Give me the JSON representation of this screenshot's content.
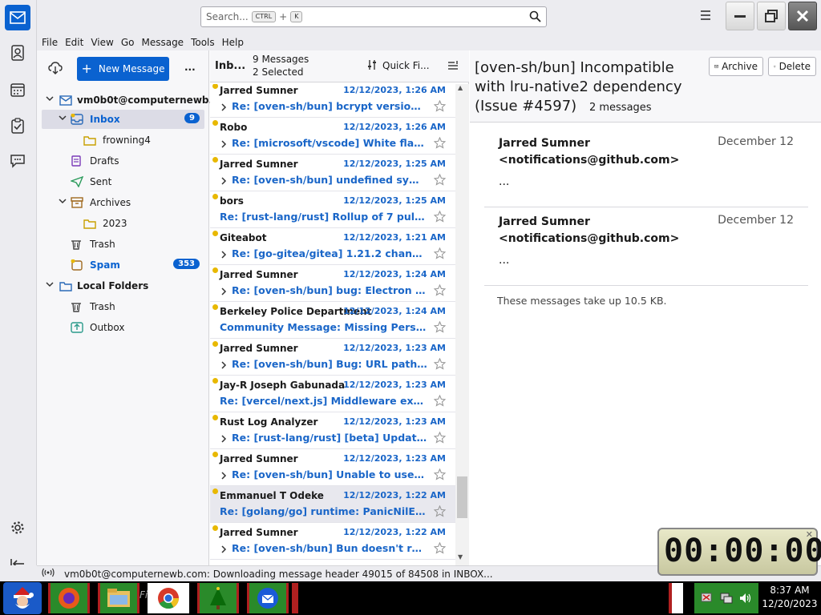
{
  "search": {
    "placeholder": "Search...",
    "key1": "CTRL",
    "plus": "+",
    "key2": "K"
  },
  "menu": [
    "File",
    "Edit",
    "View",
    "Go",
    "Message",
    "Tools",
    "Help"
  ],
  "folders": {
    "new_message": "New Message",
    "more": "...",
    "account": "vm0b0t@computernewb...",
    "items": [
      {
        "label": "Inbox",
        "badge": "9"
      },
      {
        "label": "frowning4"
      },
      {
        "label": "Drafts"
      },
      {
        "label": "Sent"
      },
      {
        "label": "Archives"
      },
      {
        "label": "2023"
      },
      {
        "label": "Trash"
      },
      {
        "label": "Spam",
        "badge": "353"
      }
    ],
    "local": "Local Folders",
    "local_items": [
      {
        "label": "Trash"
      },
      {
        "label": "Outbox"
      }
    ]
  },
  "list": {
    "folder": "Inb...",
    "count": "9 Messages",
    "selected": "2 Selected",
    "quick_filter": "Quick Fi...",
    "rows": [
      {
        "sender": "Jarred Sumner",
        "date": "12/12/2023, 1:26 AM",
        "subject": "Re: [oven-sh/bun] bcrypt version @5...."
      },
      {
        "sender": "Robo",
        "date": "12/12/2023, 1:26 AM",
        "subject": "Re: [microsoft/vscode] White flash w..."
      },
      {
        "sender": "Jarred Sumner",
        "date": "12/12/2023, 1:25 AM",
        "subject": "Re: [oven-sh/bun] undefined symbol:..."
      },
      {
        "sender": "bors",
        "date": "12/12/2023, 1:25 AM",
        "subject": "Re: [rust-lang/rust] Rollup of 7 pull req..."
      },
      {
        "sender": "Giteabot",
        "date": "12/12/2023, 1:21 AM",
        "subject": "Re: [go-gitea/gitea] 1.21.2 changelog..."
      },
      {
        "sender": "Jarred Sumner",
        "date": "12/12/2023, 1:24 AM",
        "subject": "Re: [oven-sh/bun] bug: Electron faile..."
      },
      {
        "sender": "Berkeley Police Department",
        "date": "12/12/2023, 1:24 AM",
        "subject": "Community Message: Missing Person: B..."
      },
      {
        "sender": "Jarred Sumner",
        "date": "12/12/2023, 1:23 AM",
        "subject": "Re: [oven-sh/bun] Bug: URL path join..."
      },
      {
        "sender": "Jay-R Joseph Gabunada",
        "date": "12/12/2023, 1:23 AM",
        "subject": "Re: [vercel/next.js] Middleware execute..."
      },
      {
        "sender": "Rust Log Analyzer",
        "date": "12/12/2023, 1:23 AM",
        "subject": "Re: [rust-lang/rust] [beta] Update bac..."
      },
      {
        "sender": "Jarred Sumner",
        "date": "12/12/2023, 1:23 AM",
        "subject": "Re: [oven-sh/bun] Unable to use nod..."
      },
      {
        "sender": "Emmanuel T Odeke",
        "date": "12/12/2023, 1:22 AM",
        "subject": "Re: [golang/go] runtime: PanicNilError ..."
      },
      {
        "sender": "Jarred Sumner",
        "date": "12/12/2023, 1:22 AM",
        "subject": "Re: [oven-sh/bun] Bun doesn't run in..."
      }
    ]
  },
  "reader": {
    "title": "[oven-sh/bun] Incompatible with lru-native2 dependency (Issue #4597)",
    "count": "2 messages",
    "archive": "Archive",
    "delete": "Delete",
    "messages": [
      {
        "from": "Jarred Sumner <notifications@github.com>",
        "date": "December 12",
        "body": "..."
      },
      {
        "from": "Jarred Sumner <notifications@github.com>",
        "date": "December 12",
        "body": "..."
      }
    ],
    "size_note": "These messages take up 10.5 KB."
  },
  "status": {
    "text": "vm0b0t@computernewb.com: Downloading message header 49015 of 84508 in INBOX..."
  },
  "timer": {
    "value": "00:00:00"
  },
  "taskbar": {
    "time": "8:37 AM",
    "date": "12/20/2023",
    "files_label": "Files"
  },
  "colors": {
    "accent": "#0a62d0",
    "link": "#1a66c8",
    "unread_dot": "#e8b800",
    "taskbar_app": "#2a8a2a"
  }
}
